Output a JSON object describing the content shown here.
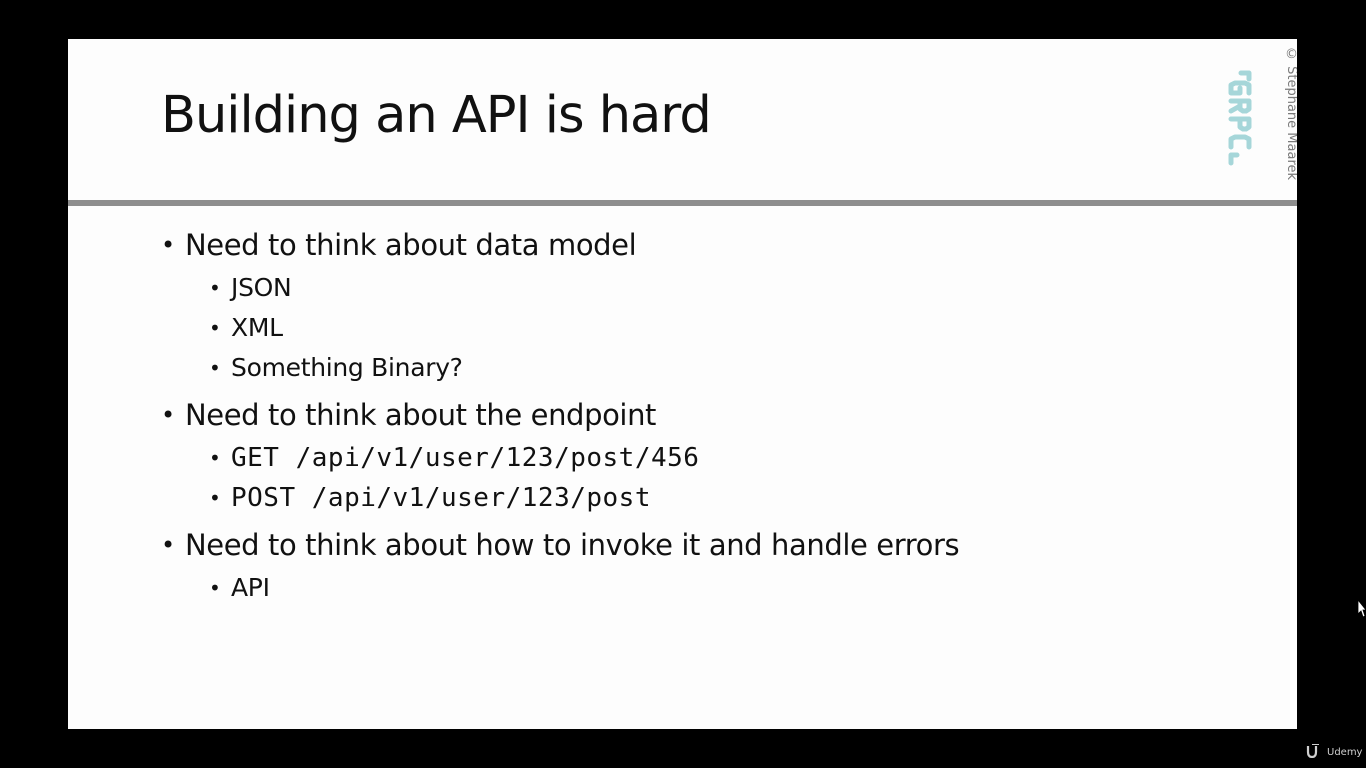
{
  "slide": {
    "title": "Building an API is hard",
    "copyright": "© Stephane Maarek",
    "logo_icon": "grpc-logo-icon",
    "accent_color": "#a6d6d9",
    "bullets": [
      {
        "text": "Need to think about data model",
        "sub": [
          "JSON",
          "XML",
          "Something Binary?"
        ]
      },
      {
        "text": "Need to think about the endpoint",
        "sub": [
          "GET /api/v1/user/123/post/456",
          "POST /api/v1/user/123/post"
        ]
      },
      {
        "text": "Need to think about how to invoke it and handle errors",
        "sub": [
          "API"
        ]
      }
    ]
  },
  "player": {
    "brand": "Udemy",
    "brand_icon": "udemy-logo-icon",
    "cursor_icon": "mouse-cursor-icon"
  }
}
